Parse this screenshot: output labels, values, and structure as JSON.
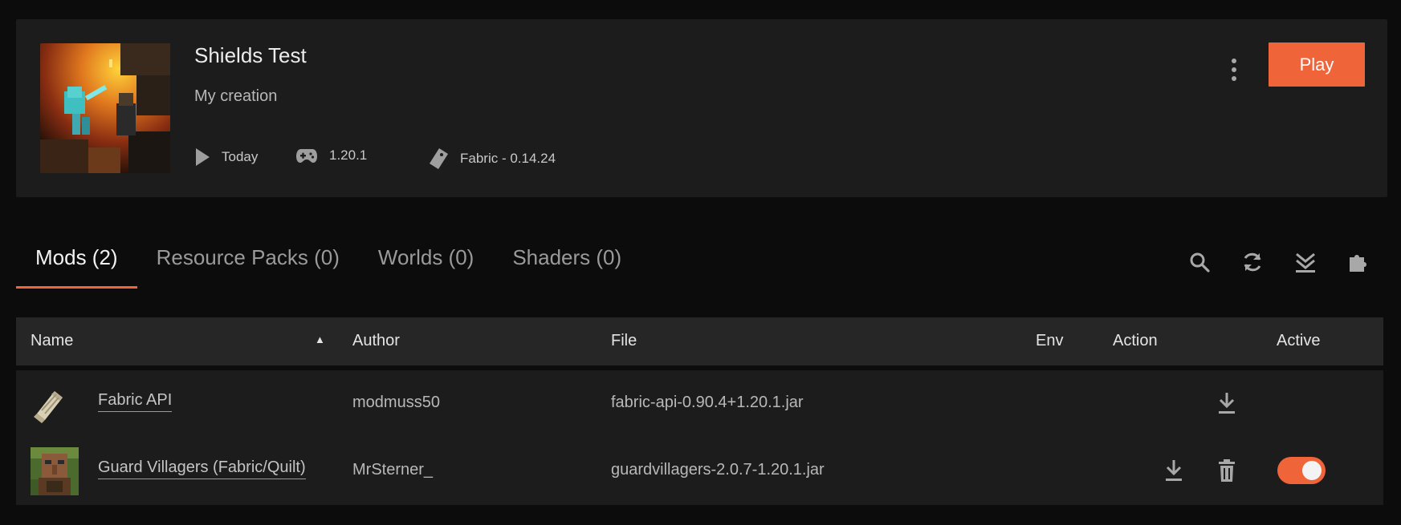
{
  "instance": {
    "title": "Shields Test",
    "subtitle": "My creation",
    "last_played": "Today",
    "game_version": "1.20.1",
    "loader": "Fabric - 0.14.24",
    "play_label": "Play"
  },
  "tabs": [
    {
      "label": "Mods (2)",
      "active": true
    },
    {
      "label": "Resource Packs (0)",
      "active": false
    },
    {
      "label": "Worlds (0)",
      "active": false
    },
    {
      "label": "Shaders (0)",
      "active": false
    }
  ],
  "toolbar": [
    "search-icon",
    "refresh-icon",
    "download-all-icon",
    "add-mod-icon"
  ],
  "table": {
    "headers": {
      "name": "Name",
      "author": "Author",
      "file": "File",
      "env": "Env",
      "action": "Action",
      "active": "Active"
    },
    "sort_indicator": "▲",
    "rows": [
      {
        "name": "Fabric API",
        "author": "modmuss50",
        "file": "fabric-api-0.90.4+1.20.1.jar",
        "actions": [
          "download"
        ],
        "active": null
      },
      {
        "name": "Guard Villagers (Fabric/Quilt)",
        "author": "MrSterner_",
        "file": "guardvillagers-2.0.7-1.20.1.jar",
        "actions": [
          "download",
          "delete"
        ],
        "active": true
      }
    ]
  },
  "colors": {
    "accent": "#f0643a",
    "background": "#0c0c0c",
    "card": "#1c1c1c",
    "table_header": "#262626"
  }
}
